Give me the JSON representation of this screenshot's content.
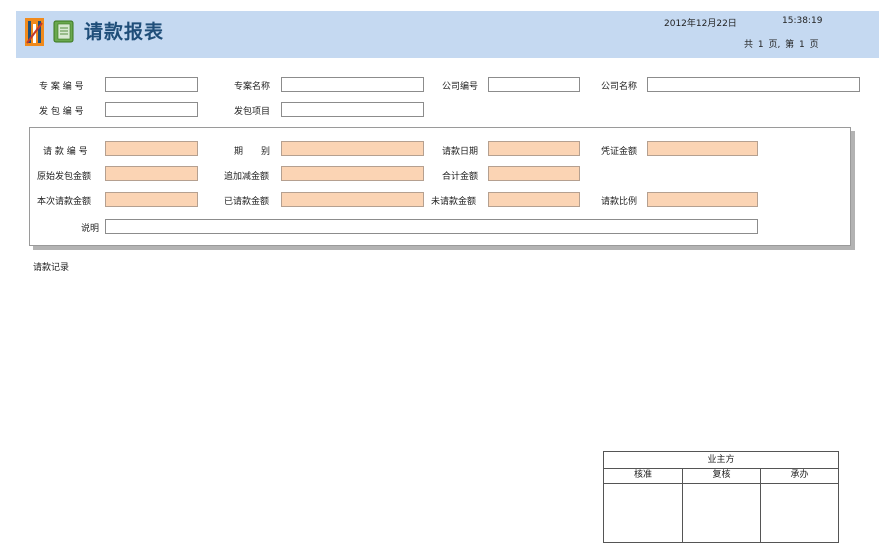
{
  "header": {
    "title": "请款报表",
    "date": "2012年12月22日",
    "time": "15:38:19",
    "pager": "共 1 页, 第 1 页",
    "logo_icon": "bars-logo-icon",
    "doc_icon": "notebook-icon"
  },
  "top_fields": {
    "project_no": {
      "label": "专 案 编 号",
      "value": ""
    },
    "project_name": {
      "label": "专案名称",
      "value": ""
    },
    "company_no": {
      "label": "公司编号",
      "value": ""
    },
    "company_name": {
      "label": "公司名称",
      "value": ""
    },
    "contract_no": {
      "label": "发 包 编 号",
      "value": ""
    },
    "contract_item": {
      "label": "发包项目",
      "value": ""
    }
  },
  "detail_fields": {
    "request_no": {
      "label": "请 款 编 号",
      "value": ""
    },
    "period": {
      "label": "期　　别",
      "value": ""
    },
    "request_date": {
      "label": "请款日期",
      "value": ""
    },
    "voucher_amount": {
      "label": "凭证金额",
      "value": ""
    },
    "original_amount": {
      "label": "原始发包金额",
      "value": ""
    },
    "adjust_amount": {
      "label": "追加减金额",
      "value": ""
    },
    "total_amount": {
      "label": "合计金额",
      "value": ""
    },
    "current_request": {
      "label": "本次请款金额",
      "value": ""
    },
    "requested_amount": {
      "label": "已请款金额",
      "value": ""
    },
    "unrequested_amount": {
      "label": "未请款金额",
      "value": ""
    },
    "request_ratio": {
      "label": "请款比例",
      "value": ""
    },
    "note": {
      "label": "说明",
      "value": ""
    }
  },
  "records": {
    "title": "请款记录"
  },
  "signoff": {
    "title": "业主方",
    "columns": [
      "核准",
      "复核",
      "承办"
    ]
  },
  "colors": {
    "header_bg": "#c5d9f1",
    "title_color": "#1f4e79",
    "highlight_field": "#fbd4b4"
  }
}
